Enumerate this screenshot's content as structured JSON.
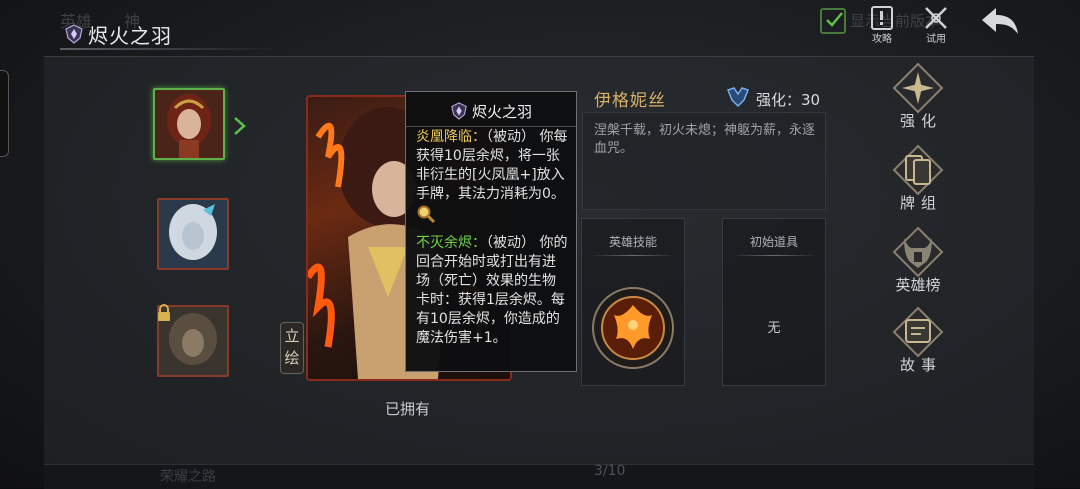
{
  "window": {
    "title": "烬火之羽"
  },
  "background_tabs": {
    "tab1": "英雄",
    "tab2": "神"
  },
  "top_bar": {
    "checkbox_label": "显示当前版本",
    "guide_label": "攻略",
    "trial_label": "试用"
  },
  "art": {
    "lihui_label": "立绘",
    "owned_label": "已拥有"
  },
  "tooltip": {
    "title": "烬火之羽",
    "skill1_name": "炎凰降临：",
    "skill1_type": "（被动）",
    "skill1_desc": "你每获得10层余烬，将一张非衍生的[火凤凰+]放入手牌，其法力消耗为0。",
    "skill2_name": "不灭余烬：",
    "skill2_type": "（被动）",
    "skill2_desc": "你的回合开始时或打出有进场（死亡）效果的生物卡时：获得1层余烬。每有10层余烬，你造成的魔法伤害+1。"
  },
  "hero": {
    "name": "伊格妮丝",
    "enhance_label": "强化：",
    "enhance_value": "30",
    "description": "涅槃千载，初火未熄；神躯为薪，永逐血咒。"
  },
  "slots": {
    "skill_title": "英雄技能",
    "item_title": "初始道具",
    "item_value": "无"
  },
  "side_menu": {
    "enhance": "强化",
    "deck": "牌组",
    "ranking": "英雄榜",
    "story": "故事"
  },
  "bottom": {
    "ghost_label": "荣耀之路",
    "page_indicator": "3/10"
  },
  "colors": {
    "accent_gold": "#d7b068",
    "passive_yellow": "#f0c85a",
    "passive_green": "#6fd24a",
    "selected_green": "#5fb04a"
  }
}
